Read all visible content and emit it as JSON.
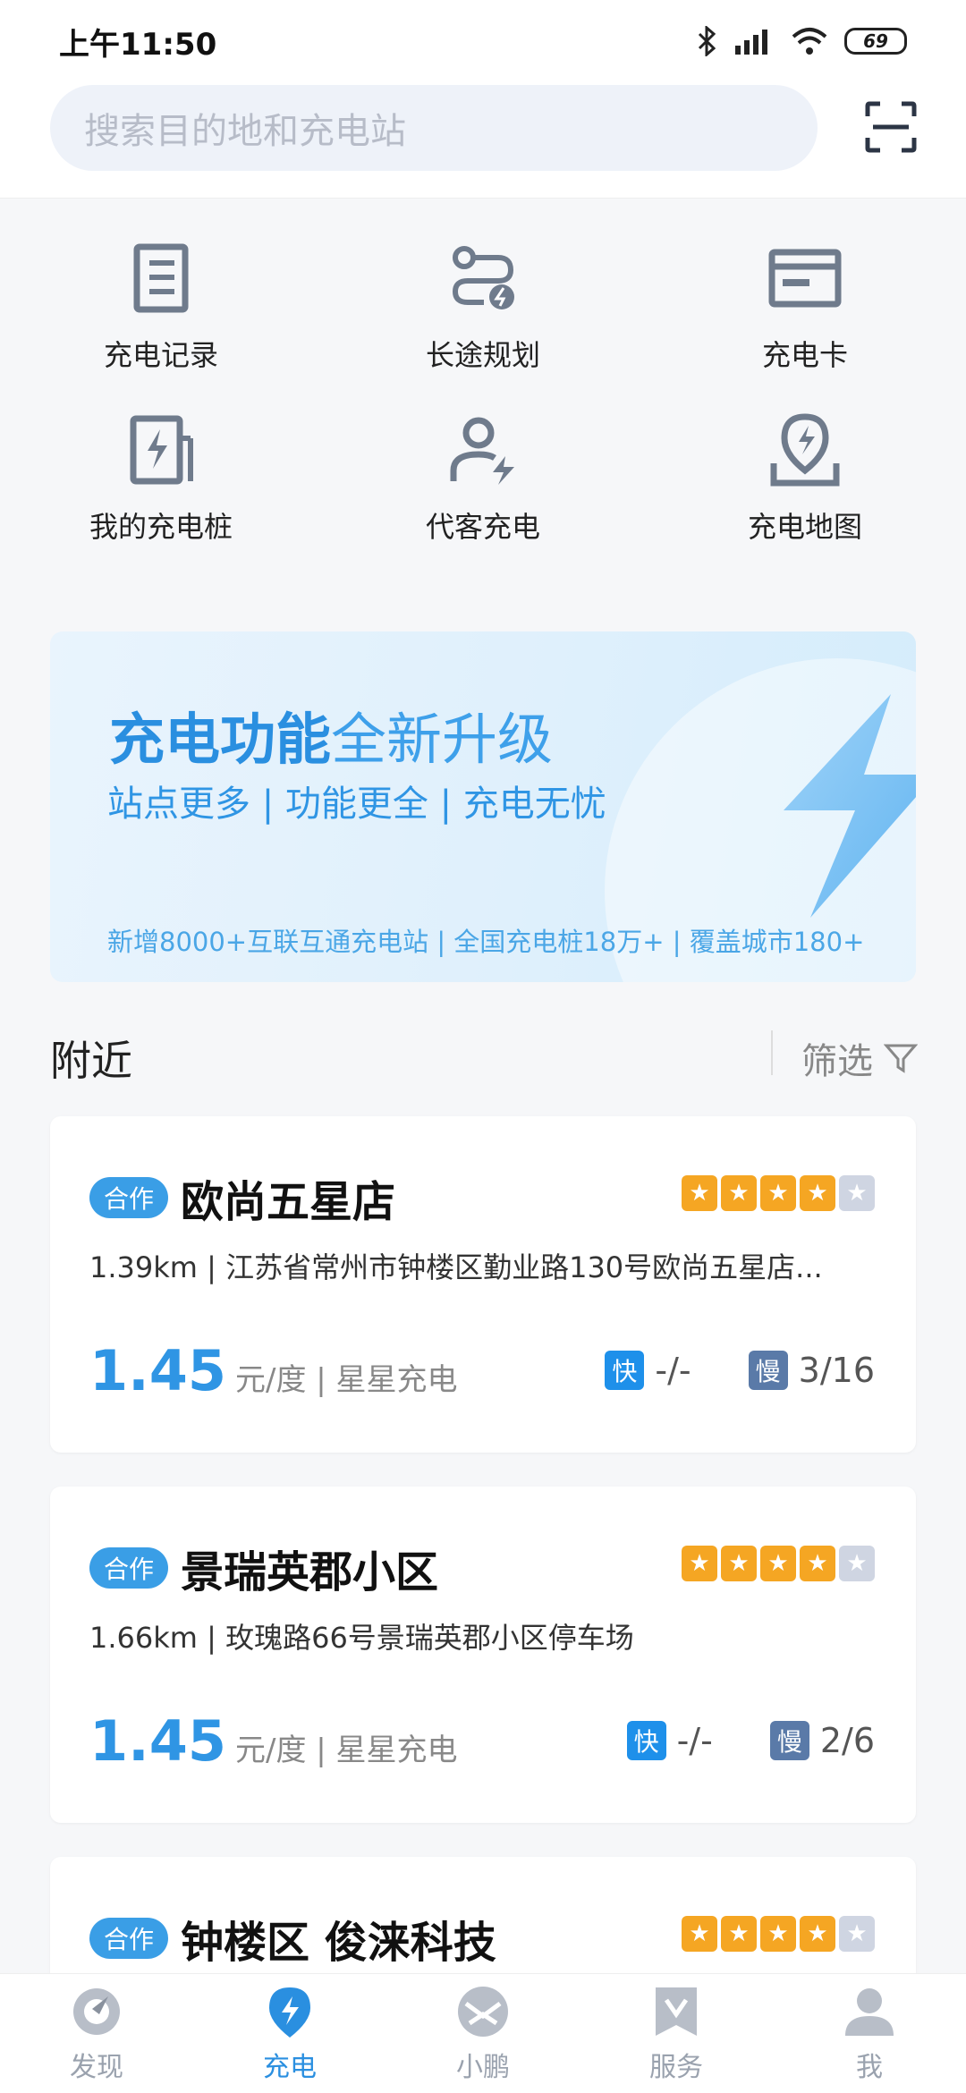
{
  "status_bar": {
    "time": "上午11:50",
    "battery": "69"
  },
  "search": {
    "placeholder": "搜索目的地和充电站"
  },
  "quick_grid": [
    {
      "label": "充电记录",
      "icon": "record-list-icon"
    },
    {
      "label": "长途规划",
      "icon": "route-plan-icon"
    },
    {
      "label": "充电卡",
      "icon": "card-icon"
    },
    {
      "label": "我的充电桩",
      "icon": "charger-pile-icon"
    },
    {
      "label": "代客充电",
      "icon": "valet-charging-icon"
    },
    {
      "label": "充电地图",
      "icon": "charging-map-icon"
    }
  ],
  "banner": {
    "title_bold": "充电功能",
    "title_light": "全新升级",
    "subtitle": "站点更多 | 功能更全 | 充电无忧",
    "footer": "新增8000+互联互通充电站 | 全国充电桩18万+ | 覆盖城市180+"
  },
  "nearby": {
    "title": "附近",
    "filter_label": "筛选"
  },
  "stations": [
    {
      "badge": "合作",
      "name": "欧尚五星店",
      "rating": 4,
      "address": "1.39km | 江苏省常州市钟楼区勤业路130号欧尚五星店...",
      "price": "1.45",
      "unit": "元/度 | 星星充电",
      "fast_label": "快",
      "fast_value": "-/-",
      "slow_label": "慢",
      "slow_value": "3/16"
    },
    {
      "badge": "合作",
      "name": "景瑞英郡小区",
      "rating": 4,
      "address": "1.66km | 玫瑰路66号景瑞英郡小区停车场",
      "price": "1.45",
      "unit": "元/度 | 星星充电",
      "fast_label": "快",
      "fast_value": "-/-",
      "slow_label": "慢",
      "slow_value": "2/6"
    },
    {
      "badge": "合作",
      "name": "钟楼区 俊涞科技",
      "rating": 4
    }
  ],
  "bottom_nav": [
    {
      "label": "发现",
      "icon": "discover-icon"
    },
    {
      "label": "充电",
      "icon": "charge-pin-icon",
      "active": true
    },
    {
      "label": "小鹏",
      "icon": "xpeng-logo-icon"
    },
    {
      "label": "服务",
      "icon": "service-icon"
    },
    {
      "label": "我",
      "icon": "profile-icon"
    }
  ],
  "colors": {
    "accent": "#2a8fe0",
    "star": "#f5a623",
    "fast_tag": "#1e90ea",
    "slow_tag": "#5a7aa8"
  }
}
